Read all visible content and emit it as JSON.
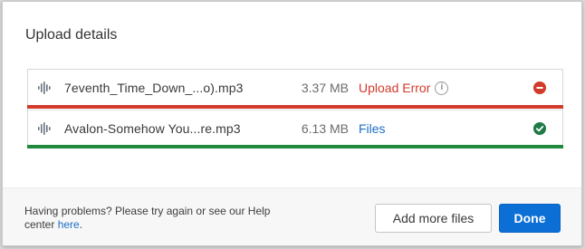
{
  "dialog": {
    "title": "Upload details"
  },
  "files": [
    {
      "name": "7eventh_Time_Down_...o).mp3",
      "size": "3.37 MB",
      "status": "Upload Error",
      "status_type": "error",
      "state_icon": "error-circle-icon",
      "progress_color": "#d23b2a",
      "progress": 1.0
    },
    {
      "name": "Avalon-Somehow You...re.mp3",
      "size": "6.13 MB",
      "status": "Files",
      "status_type": "link",
      "state_icon": "check-circle-icon",
      "progress_color": "#1f8a3b",
      "progress": 1.0
    }
  ],
  "footer": {
    "help_text_before": "Having problems? Please try again or see our Help center ",
    "help_link": "here",
    "help_text_after": ".",
    "add_more_label": "Add more files",
    "done_label": "Done"
  },
  "colors": {
    "error": "#d23b2a",
    "success": "#1f8a3b",
    "link": "#1d6ec8",
    "primary": "#0c6fd6"
  }
}
